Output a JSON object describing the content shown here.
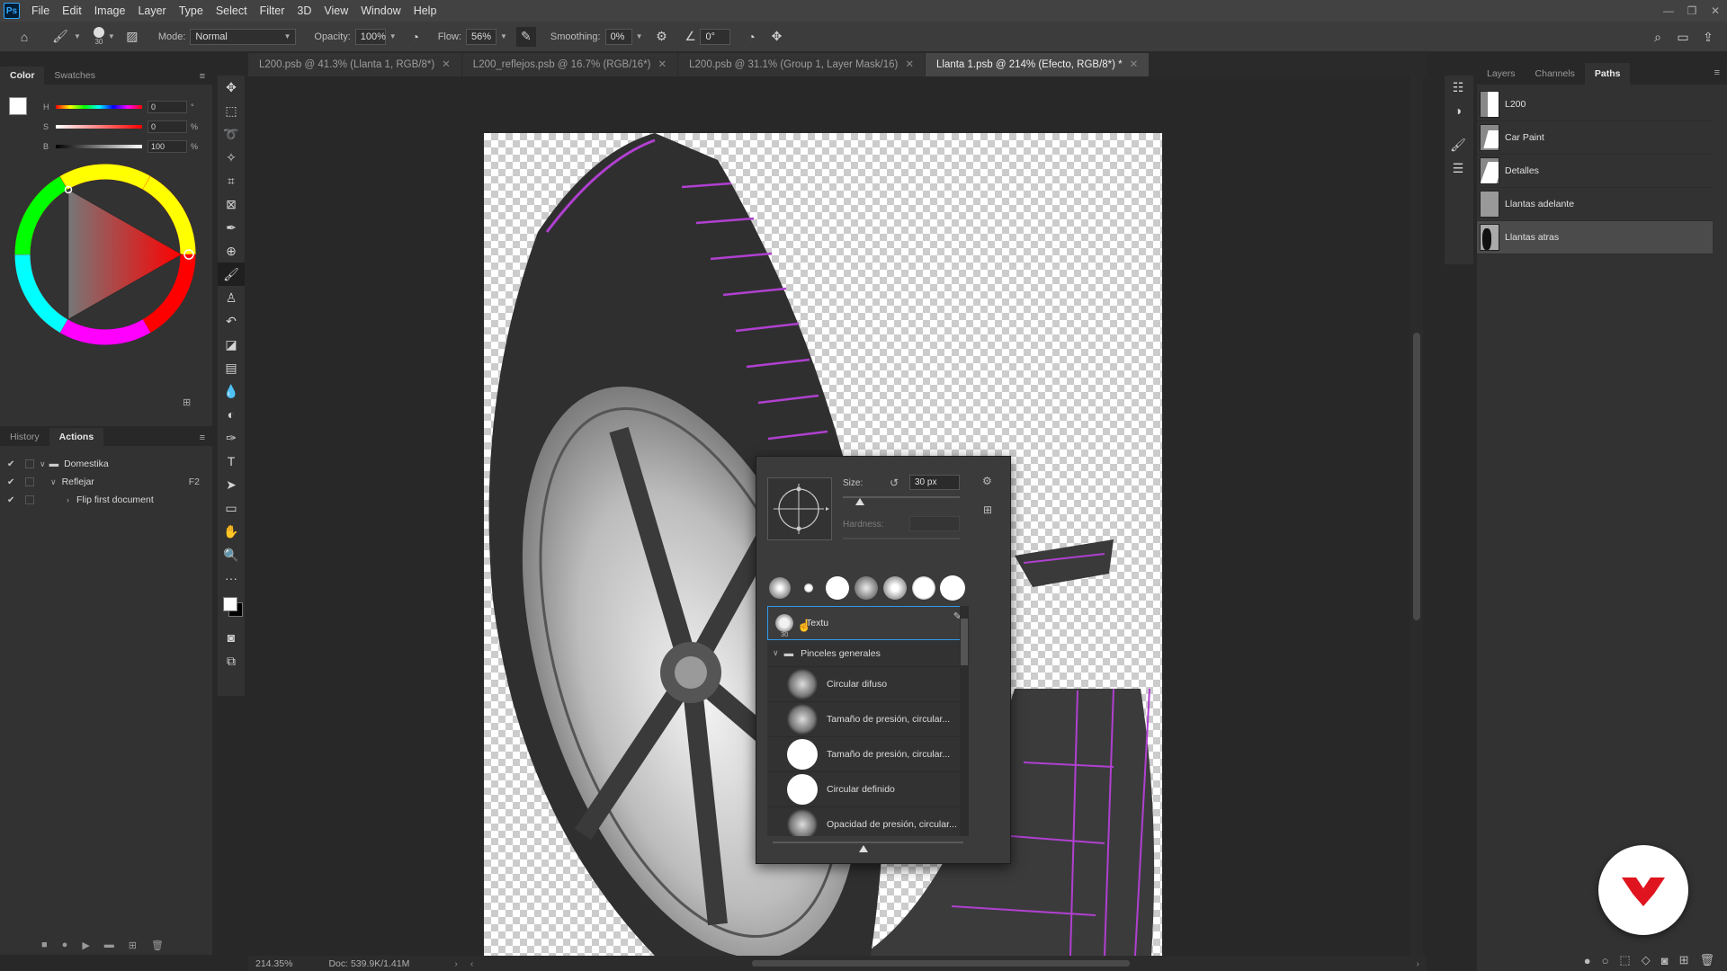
{
  "menubar": {
    "logo": "Ps",
    "items": [
      "File",
      "Edit",
      "Image",
      "Layer",
      "Type",
      "Select",
      "Filter",
      "3D",
      "View",
      "Window",
      "Help"
    ]
  },
  "options": {
    "brush_size": "30",
    "mode_label": "Mode:",
    "mode_value": "Normal",
    "opacity_label": "Opacity:",
    "opacity_value": "100%",
    "flow_label": "Flow:",
    "flow_value": "56%",
    "smoothing_label": "Smoothing:",
    "smoothing_value": "0%",
    "angle_value": "0°"
  },
  "color_panel": {
    "tabs": [
      "Color",
      "Swatches"
    ],
    "h_label": "H",
    "h_value": "0",
    "h_unit": "°",
    "s_label": "S",
    "s_value": "0",
    "s_unit": "%",
    "b_label": "B",
    "b_value": "100",
    "b_unit": "%"
  },
  "history_panel": {
    "tabs": [
      "History",
      "Actions"
    ],
    "rows": [
      {
        "label": "Domestika",
        "shortcut": ""
      },
      {
        "label": "Reflejar",
        "shortcut": "F2"
      },
      {
        "label": "Flip first document",
        "shortcut": ""
      }
    ]
  },
  "doc_tabs": [
    "L200.psb @ 41.3% (Llanta 1, RGB/8*)",
    "L200_reflejos.psb @ 16.7% (RGB/16*)",
    "L200.psb @ 31.1% (Group 1, Layer Mask/16)",
    "Llanta 1.psb @ 214% (Efecto, RGB/8*) *"
  ],
  "status": {
    "zoom": "214.35%",
    "doc": "Doc: 539.9K/1.41M"
  },
  "brush_picker": {
    "size_label": "Size:",
    "size_value": "30 px",
    "hardness_label": "Hardness:",
    "selected_preset": "Textu",
    "selected_size": "30",
    "group_name": "Pinceles generales",
    "presets": [
      {
        "name": "Circular difuso",
        "style": "soft"
      },
      {
        "name": "Tamaño de presión, circular...",
        "style": "soft"
      },
      {
        "name": "Tamaño de presión, circular...",
        "style": "hard"
      },
      {
        "name": "Circular definido",
        "style": "hard"
      },
      {
        "name": "Opacidad de presión, circular...",
        "style": "soft"
      }
    ]
  },
  "layers_panel": {
    "tabs": [
      "Layers",
      "Channels",
      "Paths"
    ],
    "paths": [
      "L200",
      "Car Paint",
      "Detalles",
      "Llantas adelante",
      "Llantas atras"
    ]
  },
  "colors": {
    "accent": "#31a8ff",
    "groove": "#b040d0",
    "badge": "#e0141e"
  }
}
